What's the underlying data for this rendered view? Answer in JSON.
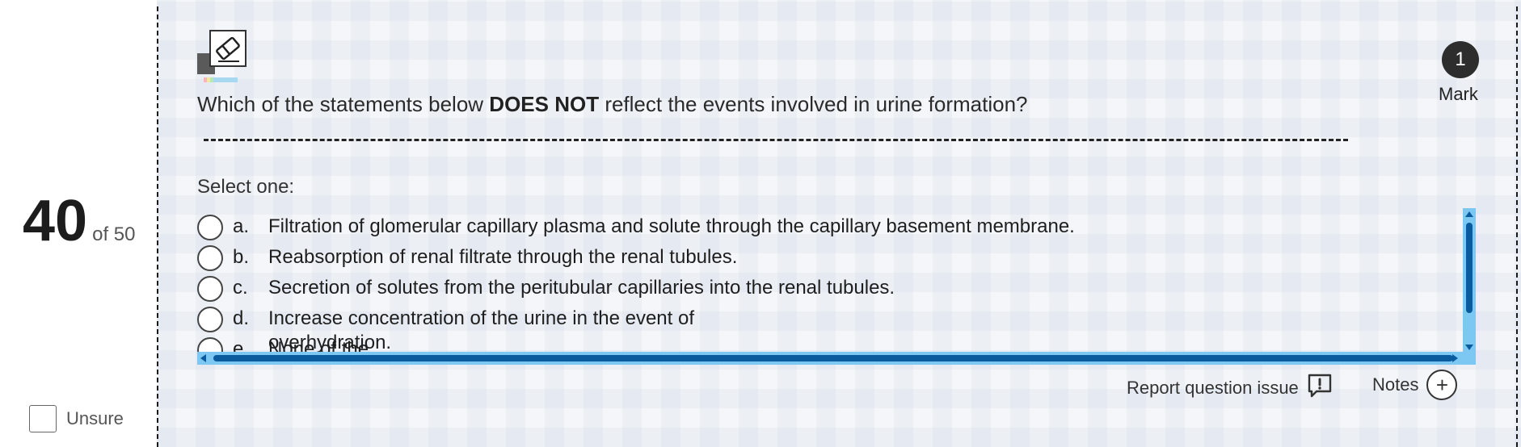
{
  "question": {
    "number": "40",
    "total": "of 50",
    "text_before": "Which of the statements below ",
    "text_bold": "DOES NOT",
    "text_after": " reflect the events involved in urine formation?",
    "marks": "1",
    "marks_label": "Mark",
    "instruction": "Select one:"
  },
  "options": [
    {
      "letter": "a.",
      "text": "Filtration of glomerular capillary plasma and solute through the capillary basement membrane."
    },
    {
      "letter": "b.",
      "text": "Reabsorption of renal filtrate through the renal tubules."
    },
    {
      "letter": "c.",
      "text": "Secretion of solutes from the peritubular capillaries into the renal tubules."
    },
    {
      "letter": "d.",
      "text": "Increase concentration of the urine in the event of",
      "text_line2": "overhydration."
    },
    {
      "letter": "e.",
      "text": "None of the"
    }
  ],
  "footer": {
    "unsure_label": "Unsure",
    "report_label": "Report question issue",
    "notes_label": "Notes"
  },
  "icons": {
    "eraser": "eraser-icon",
    "report": "report-issue-icon",
    "notes": "plus-circle-icon"
  }
}
